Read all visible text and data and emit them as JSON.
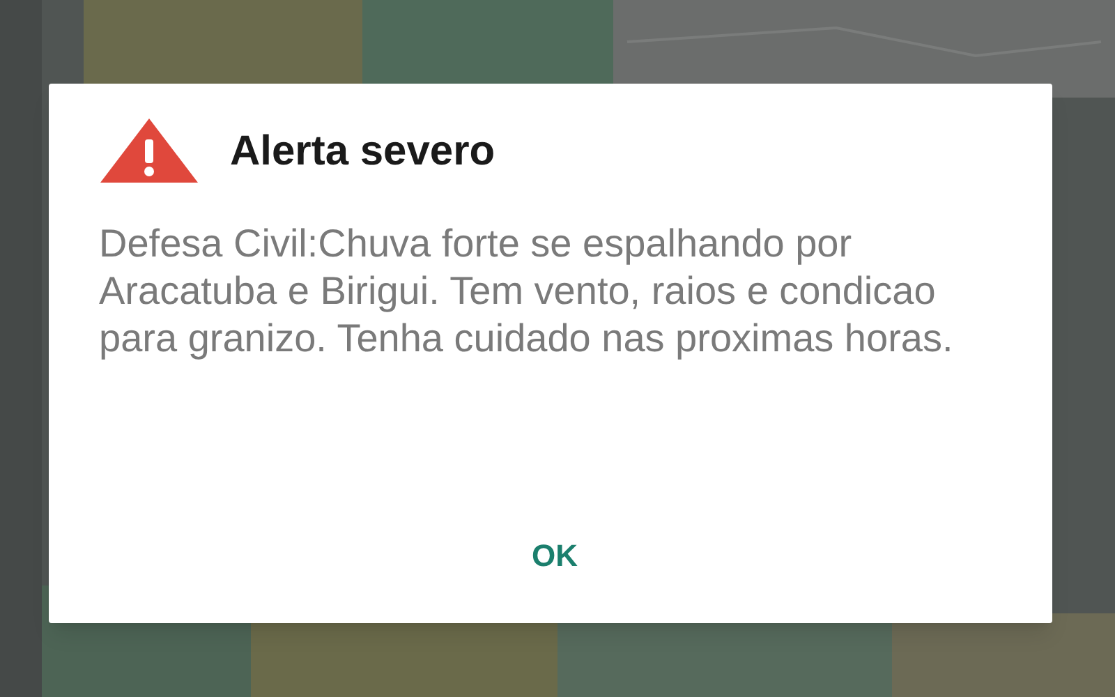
{
  "dialog": {
    "title": "Alerta severo",
    "message": "Defesa Civil:Chuva forte se espalhando por Aracatuba e Birigui. Tem vento, raios e condicao para granizo. Tenha cuidado nas proximas horas.",
    "buttons": [
      "OK"
    ]
  }
}
